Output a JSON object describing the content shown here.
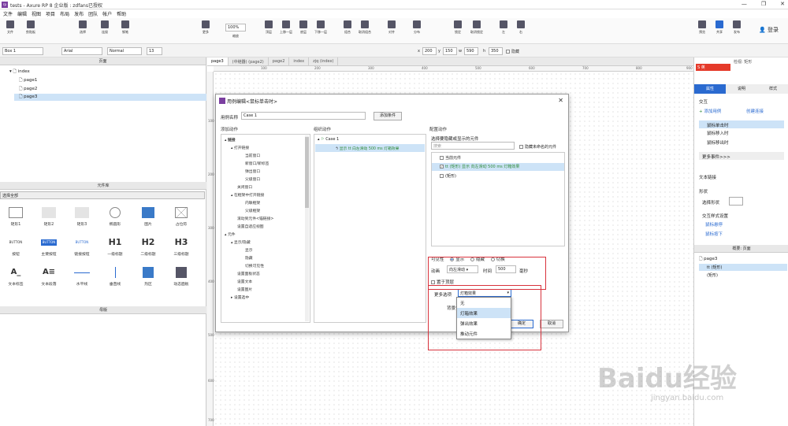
{
  "window": {
    "title": "tests - Axure RP 8 企业版 : zdfans已授权",
    "logo": "rp",
    "buttons": [
      "—",
      "❐",
      "✕"
    ]
  },
  "menu": [
    "文件",
    "编辑",
    "视图",
    "项目",
    "布局",
    "发布",
    "团队",
    "帐户",
    "帮助"
  ],
  "toolbar": {
    "items": [
      {
        "icon": "file-icon",
        "label": "文件"
      },
      {
        "icon": "clipboard-icon",
        "label": "剪贴板"
      },
      {
        "icon": "select-icon",
        "label": "选择"
      },
      {
        "icon": "connect-icon",
        "label": "连接"
      },
      {
        "icon": "pen-icon",
        "label": "钢笔"
      },
      {
        "icon": "more-icon",
        "label": "更多"
      },
      {
        "icon": "zoom-icon",
        "label": "缩放"
      },
      {
        "icon": "top-icon",
        "label": "顶层"
      },
      {
        "icon": "up-icon",
        "label": "上移一层"
      },
      {
        "icon": "bottom-icon",
        "label": "底层"
      },
      {
        "icon": "down-icon",
        "label": "下移一层"
      },
      {
        "icon": "group-icon",
        "label": "组合"
      },
      {
        "icon": "ungroup-icon",
        "label": "取消组合"
      },
      {
        "icon": "align-icon",
        "label": "对齐"
      },
      {
        "icon": "distribute-icon",
        "label": "分布"
      },
      {
        "icon": "lock-icon",
        "label": "锁定"
      },
      {
        "icon": "unlock-icon",
        "label": "取消锁定"
      },
      {
        "icon": "left-icon",
        "label": "左"
      },
      {
        "icon": "right-icon",
        "label": "右"
      },
      {
        "icon": "preview-icon",
        "label": "预览"
      },
      {
        "icon": "share-icon",
        "label": "共享"
      },
      {
        "icon": "publish-icon",
        "label": "发布"
      }
    ],
    "zoom": "100%",
    "login": "登录"
  },
  "format": {
    "style": "Box 1",
    "font": "Arial",
    "weight": "Normal",
    "size": "13",
    "x_label": "x",
    "x": "200",
    "y_label": "y",
    "y": "150",
    "w_label": "w",
    "w": "590",
    "h_label": "h",
    "h": "350",
    "hidden": "隐藏"
  },
  "pages": {
    "header": "页面",
    "items": [
      "index",
      "page1",
      "page2",
      "page3"
    ]
  },
  "library": {
    "header": "元件库",
    "selector": "选择全部",
    "items": [
      "矩形1",
      "矩形2",
      "矩形3",
      "椭圆形",
      "图片",
      "占位符",
      "按钮",
      "主要按钮",
      "链接按钮",
      "一级标题",
      "二级标题",
      "三级标题",
      "文本标签",
      "文本段落",
      "水平线",
      "垂直线",
      "热区",
      "动态面板"
    ],
    "button_text": "BUTTON",
    "headings": [
      "H1",
      "H2",
      "H3"
    ]
  },
  "masters": {
    "header": "母版"
  },
  "tabs": [
    "page3",
    "(中继器) (page2)",
    "page2",
    "index",
    "zjq (index)"
  ],
  "ruler": [
    "100",
    "200",
    "300",
    "400",
    "500",
    "600",
    "700",
    "800",
    "900"
  ],
  "ruler_v": [
    "100",
    "200",
    "300",
    "400",
    "500",
    "600",
    "700"
  ],
  "dialog": {
    "title": "用例编辑<鼠标单击时>",
    "case_label": "用例名称",
    "case_name": "Case 1",
    "add_condition": "添加条件",
    "add_action": "添加动作",
    "organize_action": "组织动作",
    "config_action": "配置动作",
    "actions": [
      {
        "t": "链接",
        "lvl": 0
      },
      {
        "t": "打开链接",
        "lvl": 1
      },
      {
        "t": "当前窗口",
        "lvl": 2
      },
      {
        "t": "新窗口/新标签",
        "lvl": 2
      },
      {
        "t": "弹出窗口",
        "lvl": 2
      },
      {
        "t": "父级窗口",
        "lvl": 2
      },
      {
        "t": "关闭窗口",
        "lvl": 1
      },
      {
        "t": "在框架中打开链接",
        "lvl": 1
      },
      {
        "t": "内联框架",
        "lvl": 2
      },
      {
        "t": "父级框架",
        "lvl": 2
      },
      {
        "t": "滚动到元件<锚链接>",
        "lvl": 1
      },
      {
        "t": "设置自适应视图",
        "lvl": 1
      },
      {
        "t": "元件",
        "lvl": 0
      },
      {
        "t": "显示/隐藏",
        "lvl": 1
      },
      {
        "t": "显示",
        "lvl": 2
      },
      {
        "t": "隐藏",
        "lvl": 2
      },
      {
        "t": "切换可见性",
        "lvl": 2
      },
      {
        "t": "设置面板状态",
        "lvl": 1
      },
      {
        "t": "设置文本",
        "lvl": 1
      },
      {
        "t": "设置图片",
        "lvl": 1
      },
      {
        "t": "设置选中",
        "lvl": 1
      }
    ],
    "org_case": "Case 1",
    "org_action": "显示 tt 向左滑动 500 ms 灯箱效果",
    "select_label": "选择要隐藏或显示的元件",
    "search_placeholder": "搜索",
    "hide_unnamed": "隐藏未命名的元件",
    "widgets": [
      {
        "t": "当前元件",
        "checked": false
      },
      {
        "t": "tt (矩形) 显示 向左滑动 500 ms 灯箱效果",
        "checked": true
      },
      {
        "t": "(矩形)",
        "checked": false
      }
    ],
    "visibility_label": "可见性",
    "vis_options": [
      "显示",
      "隐藏",
      "切换"
    ],
    "anim_label": "动画",
    "anim_value": "向左滑动",
    "time_label": "时间",
    "time_value": "500",
    "ms": "毫秒",
    "bring_front": "置于顶层",
    "more_label": "更多选项",
    "more_value": "灯箱效果",
    "bg_label": "背景色",
    "more_options": [
      "无",
      "灯箱效果",
      "弹出效果",
      "推动元件"
    ],
    "ok": "确定",
    "cancel": "取消"
  },
  "right": {
    "tabs": [
      "属性",
      "说明",
      "样式"
    ],
    "top_tabs": "检视: 矩形",
    "interaction": "交互",
    "add_case": "添加用例",
    "create_link": "创建连接",
    "events": [
      "鼠标单击时",
      "鼠标移入时",
      "鼠标移出时"
    ],
    "more_events": "更多事件>>>",
    "text_link": "文本链接",
    "shape": "形状",
    "select_shape": "选择形状",
    "interaction_style": "交互样式设置",
    "mouse_hover": "鼠标悬停",
    "mouse_down": "鼠标按下",
    "outline_tabs": [
      "概要: 页面"
    ],
    "outline_page": "page3",
    "outline_items": [
      "tt (矩形)",
      "(矩形)"
    ]
  },
  "ime": "英",
  "watermark": "Baidu经验",
  "watermark2": "jingyan.baidu.com",
  "colors": {
    "accent": "#2a6ad0",
    "red": "#d8323c",
    "purple": "#7b3fa0",
    "selected": "#cde3f7",
    "green": "#2e8b3a"
  }
}
